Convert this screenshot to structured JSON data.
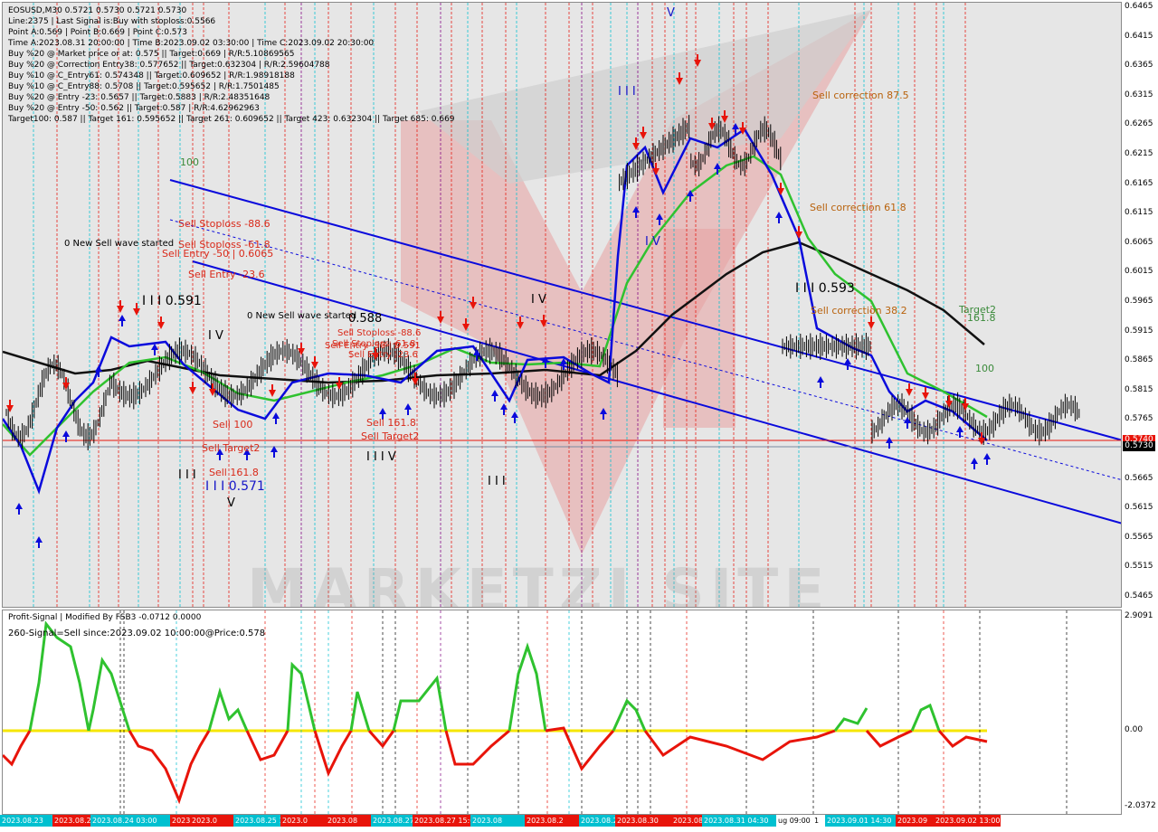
{
  "header": {
    "symbol_line": "EOSUSD,M30  0.5721 0.5730 0.5721 0.5730",
    "lines": [
      "Line:2375 | Last Signal is:Buy with stoploss:0.5566",
      "Point A:0.569 | Point B:0.669 | Point C:0.573",
      "Time A:2023.08.31 20:00:00 | Time B:2023.09.02 03:30:00 | Time C:2023.09.02 20:30:00",
      "Buy %20 @ Market price or at: 0.575 || Target:0.669 | R/R:5.10869565",
      "Buy %20 @ Correction Entry38: 0.577652 || Target:0.632304 | R/R:2.59604788",
      "Buy %10 @ C_Entry61: 0.574348 || Target:0.609652 | R/R:1.98918188",
      "Buy %10 @ C_Entry88: 0.5708 || Target:0.595652 | R/R:1.7501485",
      "Buy %20 @ Entry -23: 0.5657 || Target:0.5883 | R/R:2.48351648",
      "Buy %20 @ Entry -50: 0.562 || Target:0.587 | R/R:4.62962963",
      "Target100: 0.587 || Target 161: 0.595652 || Target 261: 0.609652 || Target 423: 0.632304 || Target 685: 0.669"
    ]
  },
  "price_axis": [
    "0.6465",
    "0.6415",
    "0.6365",
    "0.6315",
    "0.6265",
    "0.6215",
    "0.6165",
    "0.6115",
    "0.6065",
    "0.6015",
    "0.5965",
    "0.5915",
    "0.5865",
    "0.5815",
    "0.5765",
    "0.5715",
    "0.5665",
    "0.5615",
    "0.5565",
    "0.5515",
    "0.5465"
  ],
  "price_tags": {
    "red": "0.5740",
    "black": "0.5730"
  },
  "labels": {
    "l100_left": "100",
    "new_wave_1": "0 New Sell wave started",
    "new_wave_2": "0 New Sell wave started",
    "stoploss_886": "Sell Stoploss -88.6",
    "stoploss_618": "Sell Stoploss -61.8",
    "entry50": "Sell Entry -50 | 0.6065",
    "entry236": "Sell Entry -23.6",
    "w3_591": "I I I 0.591",
    "wIV_left": "I V",
    "w0588": "0.588",
    "stoploss_mid": "Sell Stoploss -88.6",
    "stoploss_mid2": "Sell Stoploss -61.8",
    "entry50_mid": "Sell Entry -50 | 0.591",
    "entry236_mid": "Sell Entry -23.6",
    "sell100": "Sell 100",
    "sell_target2_left": "Sell Target2",
    "sell1618_mid": "Sell 161.8",
    "sell_target2_mid": "Sell Target2",
    "sell1618_left": "Sell 161.8",
    "wIII_left": "I I I",
    "w0571": "I I I 0.571",
    "wV_left": "V",
    "wIIIV": "I I I V",
    "wIII_mid": "I I I",
    "wIV_mid": "I V",
    "wIII_top": "I I I",
    "wV_top": "V",
    "wIV_right": "I V",
    "w0593": "I I I 0.593",
    "sell_corr_875": "Sell correction 87.5",
    "sell_corr_618": "Sell correction 61.8",
    "sell_corr_382": "Sell correction 38.2",
    "target2": "Target2",
    "t1618": "161.8",
    "l100_right": "100",
    "wm_letters": "MARKETZI SITE"
  },
  "indicator": {
    "title": "Profit-Signal | Modified By FSB3 -0.0712 0.0000",
    "signal": "260-Signal=Sell since:2023.09.02 10:00:00@Price:0.578",
    "axis_top": "2.9091",
    "axis_zero": "0.00",
    "axis_bottom": "-2.0372"
  },
  "dates": [
    "2023.08.23",
    "2023.08.2",
    "2023.08.24 03:00",
    "2023.0",
    "2023.0",
    "2023.08.25 13",
    "2023.0",
    "2023.08",
    "2023.08.27",
    "2023.08.27 15:0",
    "2023.08",
    "2023.08.2",
    "2023.08.29",
    "2023.08.30",
    "2023.08.30",
    "2023.08.31 04:30",
    "ug 09:00",
    "1",
    "2023.09.01 14:30",
    "2023.09",
    "2023.09.02 13:00"
  ],
  "colors": {
    "bg": "#e6e6e6",
    "blue": "#0a0adc",
    "green": "#2fc22f",
    "black": "#111111",
    "red": "#e8140a",
    "watermark": "#e8a0a0"
  }
}
